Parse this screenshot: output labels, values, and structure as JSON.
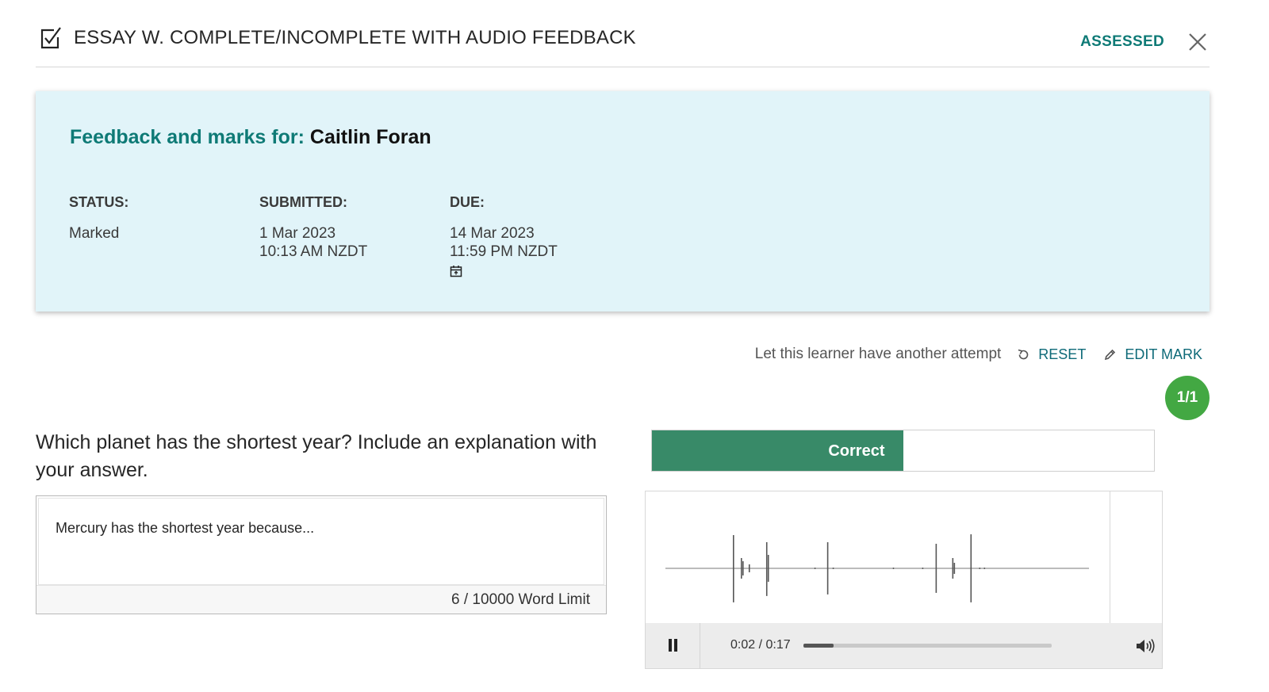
{
  "header": {
    "title": "ESSAY W. COMPLETE/INCOMPLETE WITH AUDIO FEEDBACK",
    "status": "ASSESSED",
    "title_icon": "checkbox-check-icon",
    "close_icon": "close-icon"
  },
  "feedback": {
    "heading_lead": "Feedback and marks for:",
    "learner_name": "Caitlin Foran",
    "status_label": "STATUS:",
    "status_value": "Marked",
    "submitted_label": "SUBMITTED:",
    "submitted_date": "1 Mar 2023",
    "submitted_time": "10:13 AM NZDT",
    "due_label": "DUE:",
    "due_date": "14 Mar 2023",
    "due_time": "11:59 PM NZDT",
    "calendar_icon": "calendar-icon"
  },
  "actions": {
    "hint": "Let this learner have another attempt",
    "reset_label": "RESET",
    "edit_mark_label": "EDIT MARK"
  },
  "score": "1/1",
  "question": "Which planet has the shortest year? Include an explanation with your answer.",
  "answer": {
    "text": "Mercury has the shortest year because...",
    "word_count": "6",
    "word_limit_text": "/ 10000 Word Limit"
  },
  "result": {
    "label": "Correct",
    "fill_fraction": 0.5
  },
  "audio": {
    "time": "0:02 / 0:17",
    "progress_fraction": 0.12,
    "pause_icon": "pause-icon",
    "volume_icon": "volume-icon"
  },
  "colors": {
    "accent_teal": "#0e7a76",
    "card_bg": "#e1f4f9",
    "correct_green": "#388a68",
    "badge_green": "#43a843"
  }
}
